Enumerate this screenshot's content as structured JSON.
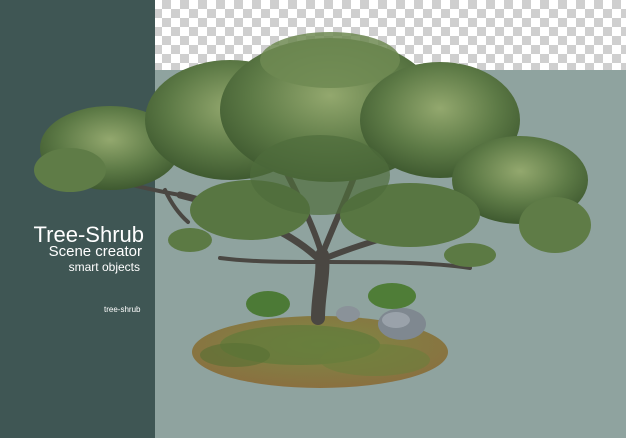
{
  "poster": {
    "title": "Tree-Shrub",
    "subtitle": "Scene creator",
    "tagline": "smart objects",
    "tag_label": "tree-shrub"
  },
  "artwork": {
    "subject": "tree-shrub-illustration",
    "transparency_pattern": "checkerboard",
    "colors": {
      "panel": "#3f5654",
      "background": "#8fa39f",
      "foliage": "#4e6c3c",
      "foliage_light": "#8fa36a",
      "trunk": "#4a4742",
      "grass": "#8a7a4a",
      "rock": "#7f8890"
    }
  }
}
